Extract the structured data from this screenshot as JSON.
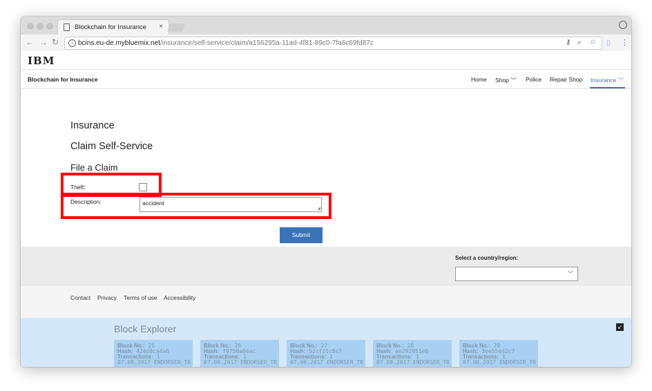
{
  "browser": {
    "tab_title": "Blockchain for Insurance",
    "tab_close": "×",
    "url_host": "bcins.eu-de.mybluemix.net",
    "url_path": "/insurance/self-service/claim/a156295a-11ad-4f81-89c0-7fa6c69fd87c"
  },
  "site": {
    "logo": "IBM",
    "brand": "Blockchain for Insurance",
    "nav": [
      "Home",
      "Shop",
      "Police",
      "Repair Shop",
      "Insurance"
    ]
  },
  "page": {
    "title": "Insurance",
    "subtitle": "Claim Self-Service",
    "form_title": "File a Claim",
    "theft_label": "Theft:",
    "description_label": "Description:",
    "description_value": "accident",
    "submit_label": "Submit"
  },
  "country": {
    "label": "Select a country/region:",
    "selected": ""
  },
  "footer": {
    "links": [
      "Contact",
      "Privacy",
      "Terms of use",
      "Accessibility"
    ]
  },
  "explorer": {
    "title": "Block Explorer",
    "field_labels": {
      "block": "Block No.:",
      "hash": "Hash:",
      "tx": "Transactions:"
    },
    "blocks": [
      {
        "no": "25",
        "hash": "424d0ca4a6",
        "tx": "1",
        "info": "07.08.2017 ENDORSER_TR"
      },
      {
        "no": "26",
        "hash": "f9758a04ac",
        "tx": "1",
        "info": "07.08.2017 ENDORSER_TR"
      },
      {
        "no": "27",
        "hash": "52cf21c8c7",
        "tx": "1",
        "info": "07.08.2017 ENDORSER_TR"
      },
      {
        "no": "28",
        "hash": "ae292951e6",
        "tx": "1",
        "info": "07.08.2017 ENDORSER_TR"
      },
      {
        "no": "29",
        "hash": "3ee55ad2c7",
        "tx": "1",
        "info": "07.08.2017 ENDORSER_TR"
      }
    ]
  }
}
